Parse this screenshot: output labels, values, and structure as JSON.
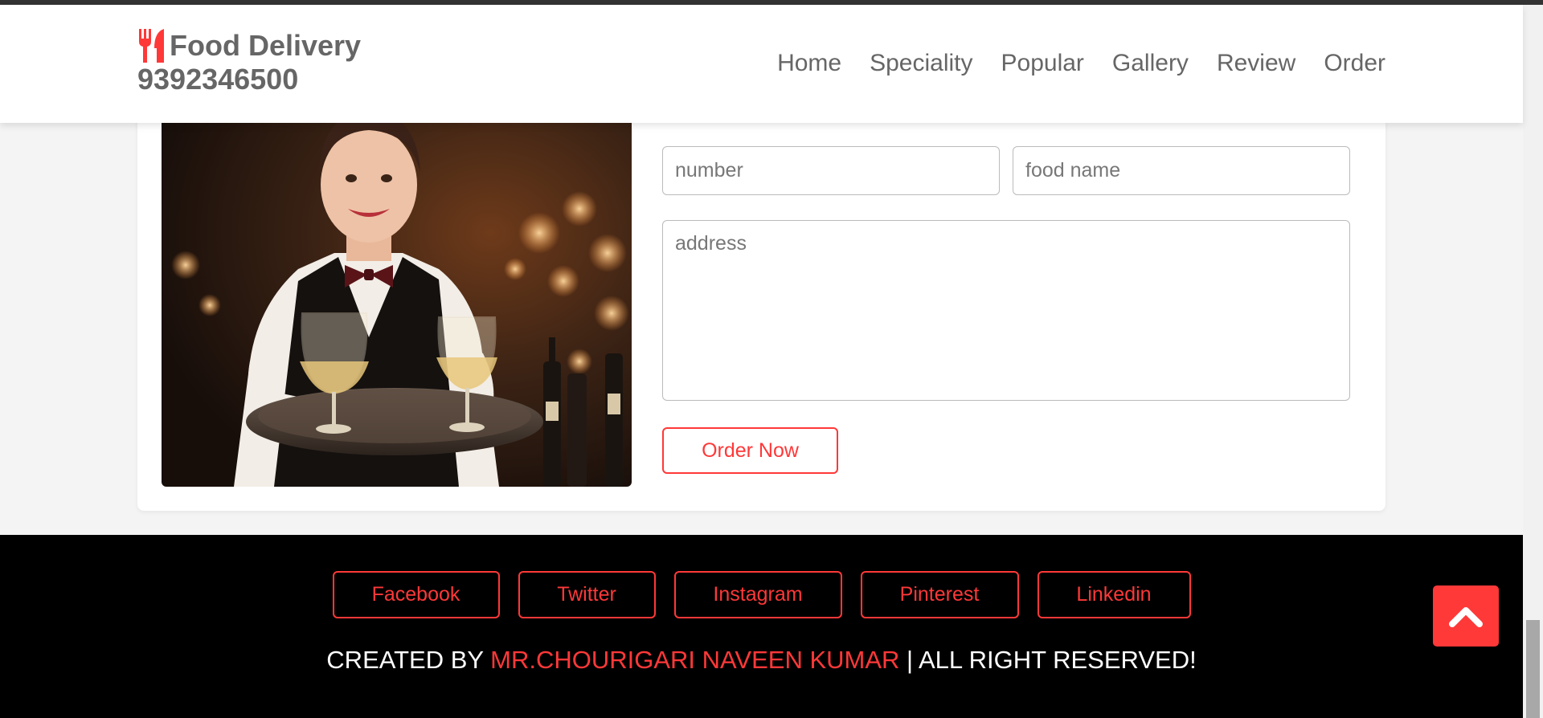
{
  "header": {
    "brand": "Food Delivery",
    "phone": "9392346500",
    "nav": [
      "Home",
      "Speciality",
      "Popular",
      "Gallery",
      "Review",
      "Order"
    ]
  },
  "order_form": {
    "number_placeholder": "number",
    "food_placeholder": "food name",
    "address_placeholder": "address",
    "submit_label": "Order Now"
  },
  "footer": {
    "socials": [
      "Facebook",
      "Twitter",
      "Instagram",
      "Pinterest",
      "Linkedin"
    ],
    "credit_prefix": "CREATED BY",
    "credit_name": "MR.CHOURIGARI NAVEEN KUMAR",
    "credit_suffix": "| ALL RIGHT RESERVED!"
  },
  "icons": {
    "logo": "utensils-icon",
    "scroll_top": "chevron-up-icon"
  },
  "colors": {
    "accent": "#ff3838",
    "text_gray": "#666666",
    "footer_bg": "#000000"
  }
}
